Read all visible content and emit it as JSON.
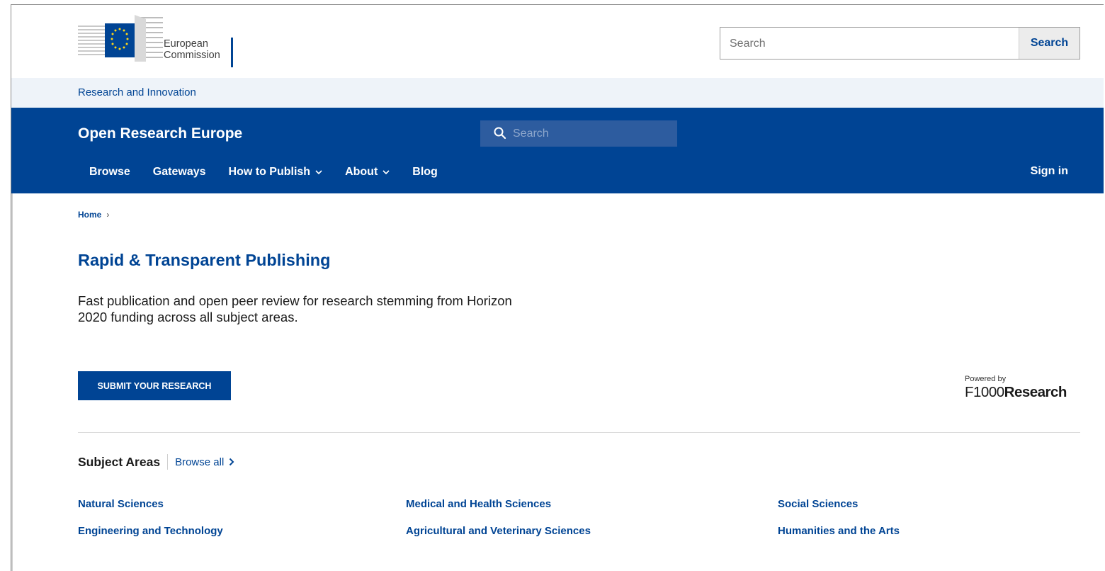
{
  "ec_header": {
    "logo_line1": "European",
    "logo_line2": "Commission",
    "search_placeholder": "Search",
    "search_button": "Search"
  },
  "site_bar": {
    "label": "Research and Innovation"
  },
  "ore_nav": {
    "title": "Open Research Europe",
    "search_placeholder": "Search",
    "items": [
      {
        "label": "Browse",
        "has_dropdown": false
      },
      {
        "label": "Gateways",
        "has_dropdown": false
      },
      {
        "label": "How to Publish",
        "has_dropdown": true
      },
      {
        "label": "About",
        "has_dropdown": true
      },
      {
        "label": "Blog",
        "has_dropdown": false
      }
    ],
    "sign_in": "Sign in"
  },
  "breadcrumb": {
    "home": "Home",
    "separator": "›"
  },
  "hero": {
    "title": "Rapid & Transparent Publishing",
    "description_line1": "Fast publication and open peer review for research stemming from Horizon",
    "description_line2": "2020 funding across all subject areas.",
    "submit_button": "SUBMIT YOUR RESEARCH"
  },
  "powered_by": {
    "label": "Powered by",
    "brand_light": "F1000",
    "brand_bold": "Research"
  },
  "subject_areas": {
    "title": "Subject Areas",
    "browse_all": "Browse all",
    "items": [
      "Natural Sciences",
      "Medical and Health Sciences",
      "Social Sciences",
      "Engineering and Technology",
      "Agricultural and Veterinary Sciences",
      "Humanities and the Arts"
    ]
  },
  "colors": {
    "primary_blue": "#004494",
    "site_bar_bg": "#eef3f9",
    "nav_search_bg": "#2d5c9f",
    "eu_yellow": "#ffd617"
  }
}
